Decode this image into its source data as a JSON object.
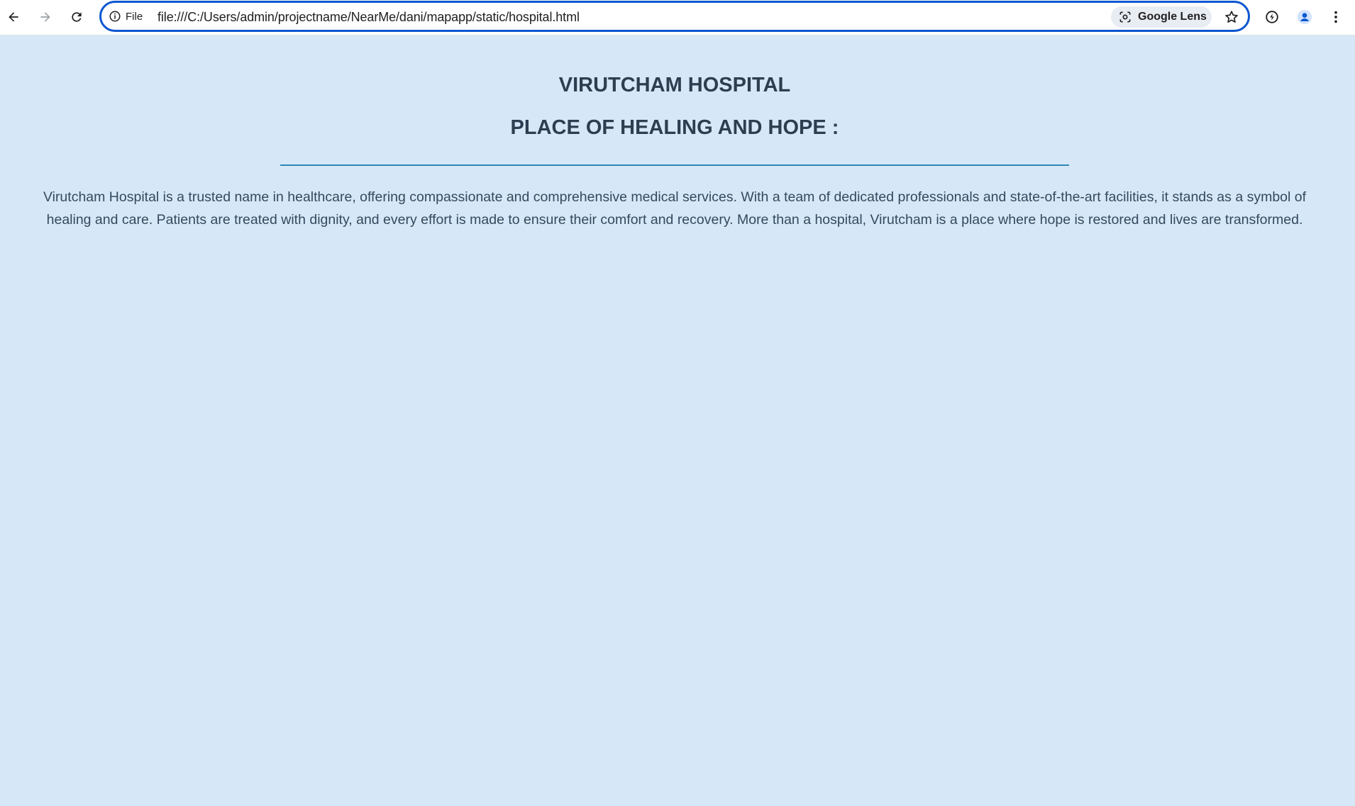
{
  "browser": {
    "site_info_label": "File",
    "url": "file:///C:/Users/admin/projectname/NearMe/dani/mapapp/static/hospital.html",
    "lens_label": "Google Lens"
  },
  "page": {
    "title": "VIRUTCHAM HOSPITAL",
    "subtitle": "PLACE OF HEALING AND HOPE :",
    "description": "Virutcham Hospital is a trusted name in healthcare, offering compassionate and comprehensive medical services. With a team of dedicated professionals and state-of-the-art facilities, it stands as a symbol of healing and care. Patients are treated with dignity, and every effort is made to ensure their comfort and recovery. More than a hospital, Virutcham is a place where hope is restored and lives are transformed."
  },
  "colors": {
    "page_background": "#d6e8f7",
    "heading": "#2c3e50",
    "divider": "#2e86b8",
    "body_text": "#34495e",
    "omnibox_focus": "#0b57d0"
  }
}
